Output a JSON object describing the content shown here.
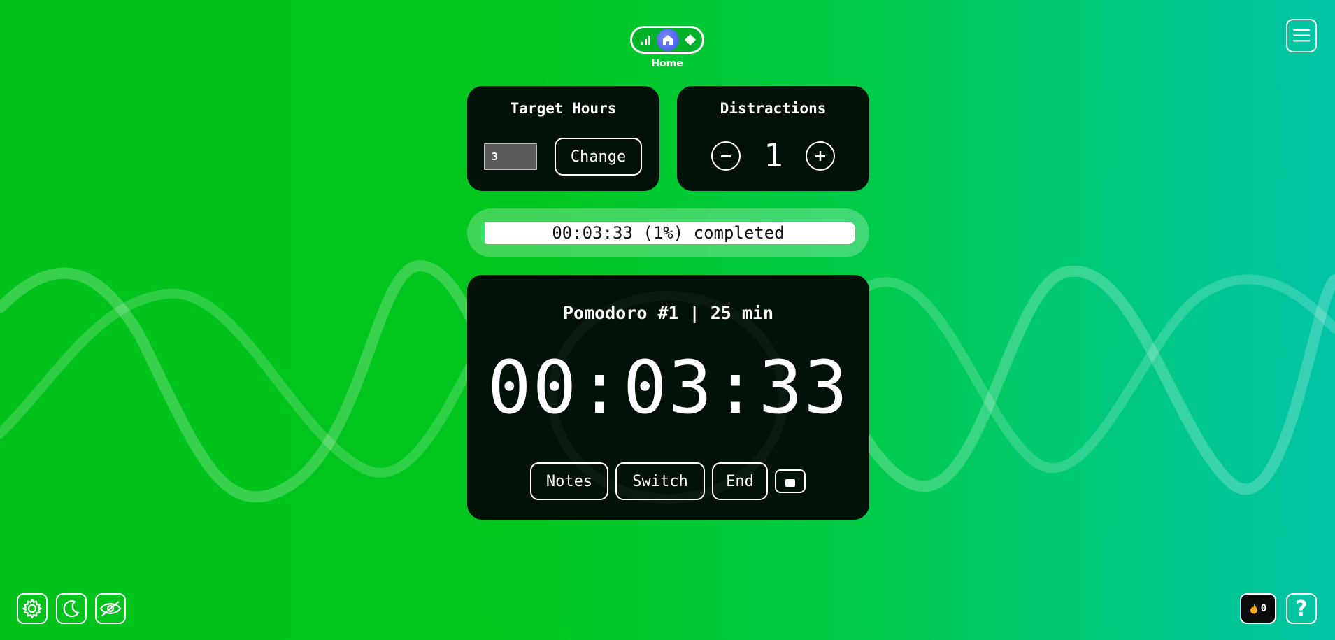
{
  "nav": {
    "active_label": "Home",
    "icons": [
      "stats-icon",
      "home-icon",
      "diamond-icon"
    ]
  },
  "target_hours": {
    "title": "Target Hours",
    "value": "3",
    "change_label": "Change"
  },
  "distractions": {
    "title": "Distractions",
    "count": "1",
    "decrement_symbol": "−",
    "increment_symbol": "+"
  },
  "progress": {
    "text": "00:03:33 (1%) completed",
    "percent": 1
  },
  "timer": {
    "title": "Pomodoro #1 | 25 min",
    "display": "00:03:33",
    "buttons": {
      "notes": "Notes",
      "switch": "Switch",
      "end": "End"
    }
  },
  "footer": {
    "streak_count": "0",
    "help_symbol": "?",
    "icons": [
      "gear-icon",
      "moon-icon",
      "eye-off-icon"
    ]
  },
  "colors": {
    "background_start": "#00c21a",
    "background_end": "#00c4a6",
    "card_bg": "#031208",
    "nav_active": "#4a5ee6",
    "streak_flame": "#f5a623"
  }
}
